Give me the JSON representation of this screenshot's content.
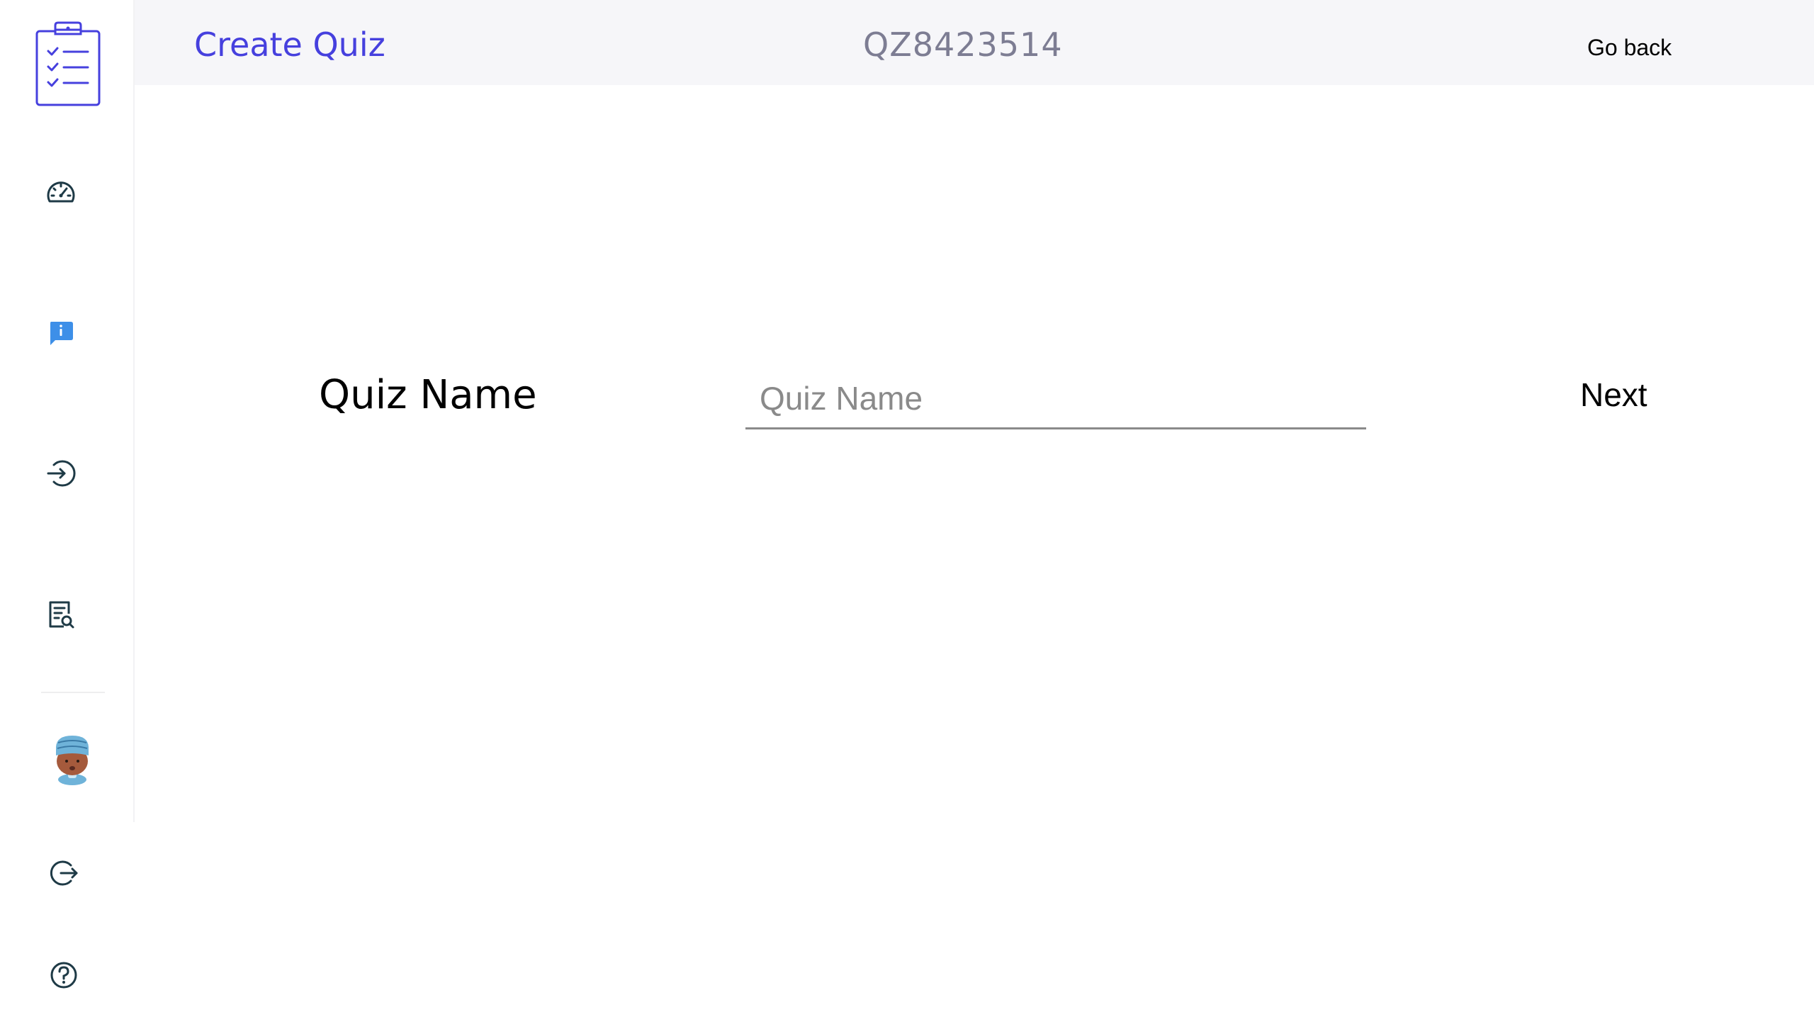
{
  "header": {
    "title": "Create Quiz",
    "quiz_code": "QZ8423514",
    "go_back_label": "Go back"
  },
  "sidebar": {
    "items": [
      {
        "icon": "clipboard-checklist-icon"
      },
      {
        "icon": "dashboard-gauge-icon"
      },
      {
        "icon": "info-message-icon"
      },
      {
        "icon": "join-enter-icon"
      },
      {
        "icon": "results-search-icon"
      },
      {
        "icon": "user-avatar"
      },
      {
        "icon": "logout-icon"
      },
      {
        "icon": "help-icon"
      }
    ]
  },
  "form": {
    "label": "Quiz Name",
    "input_placeholder": "Quiz Name",
    "input_value": "",
    "next_label": "Next"
  },
  "colors": {
    "accent": "#4640de",
    "code_gray": "#7d7d93",
    "header_bg": "#f6f6f9",
    "icon_dark": "#1e3a46",
    "info_blue": "#3d8fe8"
  }
}
